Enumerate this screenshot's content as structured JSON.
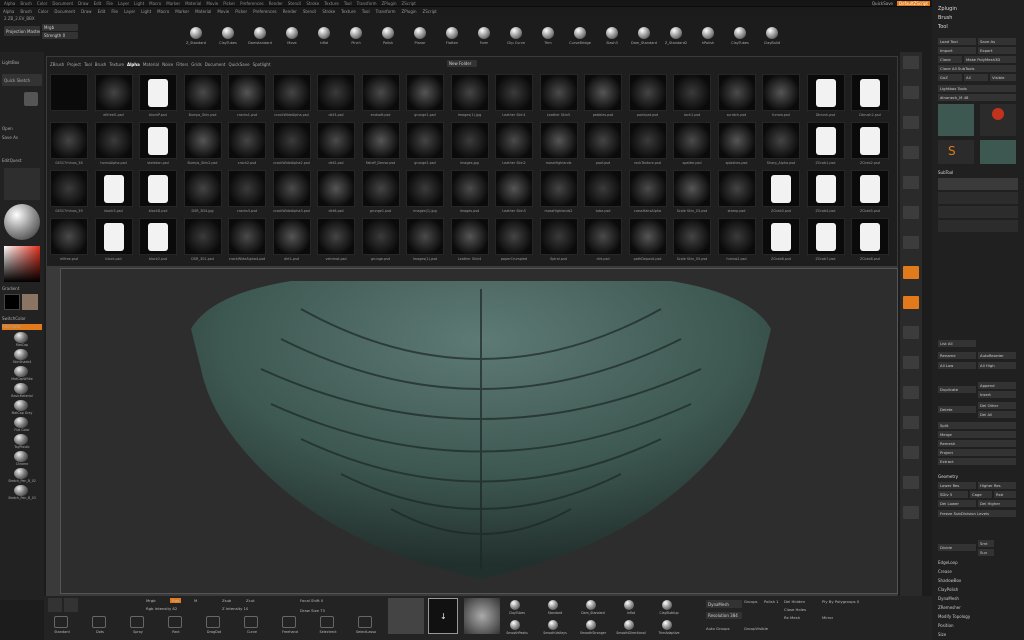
{
  "app": {
    "version": "2.ZB_2.EV_BBX",
    "status": "Active"
  },
  "top_menu": [
    "Alpha",
    "Brush",
    "Color",
    "Document",
    "Draw",
    "Edit",
    "File",
    "Layer",
    "Light",
    "Macro",
    "Marker",
    "Material",
    "Movie",
    "Picker",
    "Preferences",
    "Render",
    "Stencil",
    "Stroke",
    "Texture",
    "Tool",
    "Transform",
    "ZPlugin",
    "ZScript"
  ],
  "top_right": {
    "zplugin": "Zplugin",
    "brush": "Brush",
    "tool": "Tool",
    "quicksave": "QuickSave",
    "default": "DefaultZScript"
  },
  "left": {
    "projection_master": "Projection Master",
    "lightbox": "LightBox",
    "quick_sketch": "Quick Sketch",
    "open": "Open",
    "save_as": "Save As",
    "gradient": "Gradient",
    "switch_color": "SwitchColor",
    "alternate": "Alternate",
    "materials": [
      "MatCap",
      "SkinShade4",
      "MatCapWhite",
      "BasicMaterial",
      "MatCap Gray",
      "Flat Color",
      "ToyPlastic",
      "Chrome",
      "Sketch_Pen_B_02",
      "Sketch_Pen_B_03"
    ]
  },
  "top_shelf": [
    "Z_Standard",
    "ClayTubes",
    "Damstandard",
    "Move",
    "Inflat",
    "Pinch",
    "Polish",
    "Planar",
    "Flatten",
    "Form",
    "Clip Curve",
    "Trim",
    "CurveBridge",
    "Slash3",
    "Dam_Standard",
    "Z_Standard2",
    "hPolish",
    "ClayTubes",
    "ClayBuild"
  ],
  "draw": {
    "mrgb": "Mrgb",
    "rgb": "Rgb",
    "m": "M",
    "zadd": "Zadd",
    "zsub": "Zsub",
    "zcut": "Zcut",
    "focal_shift": "Focal Shift 0",
    "draw_size": "Draw Size 73",
    "rgb_intensity": "Rgb Intensity 82",
    "z_intensity": "Z Intensity 10",
    "strength": "Strength 0"
  },
  "popup": {
    "tabs": [
      "ZBrush",
      "Project",
      "Tool",
      "Brush",
      "Texture",
      "Alpha",
      "Material",
      "Noise",
      "Filters",
      "Grids",
      "Document",
      "QuickSave",
      "Spotlight"
    ],
    "active_tab": "Alpha",
    "new_folder": "New Folder",
    "alphas": [
      [
        "",
        "ellfreeG.psd",
        "blockP.psd",
        "Bumps_Skin.psd",
        "cracks1.psd",
        "crackWideAlpha.psd",
        "dirt3.psd",
        "endsoft.psd",
        "grunge1.psd",
        "Images(1).jpg",
        "Leather Skin1",
        "Leather Skin5",
        "pebbles.psd",
        "paintpat.psd",
        "rock1.psd",
        "scratch.psd",
        "furrow.psd",
        "Dbrush.psd",
        "Dbrush2.psd"
      ],
      [
        "04517rhinos_38",
        "hornsAlpha.psd",
        "skeleton.psd",
        "Bumps_Skin2.psd",
        "crack2.psd",
        "crackWideAlpha2.psd",
        "dirt2.psd",
        "Falloff_Dense.psd",
        "grunge2.psd",
        "images.jpg",
        "Leather Skin2",
        "mossHighlands",
        "poof.psd",
        "rockTexture.psd",
        "spatter.psd",
        "splashes.psd",
        "Sharp_Alpha.psd",
        "ZGrab1.psd",
        "ZGrab2.psd"
      ],
      [
        "04517rhinos_39",
        "block3.psd",
        "blockD.psd",
        "DSR_3D4.jpg",
        "cracks3.psd",
        "crackWideAlpha3.psd",
        "dirt6.psd",
        "grunge1.psd",
        "images(1).jpg",
        "images.psd",
        "Leather Skin3",
        "mossHighlands2",
        "tube.psd",
        "crossHairsAlpha",
        "Scale Skin_03.psd",
        "stamp.psd",
        "ZGrab3.psd",
        "ZGrab4.psd",
        "ZGrab5.psd"
      ],
      [
        "ellfree.psd",
        "block.psd",
        "block2.psd",
        "DSR_301.psd",
        "crackWideAlpha4.psd",
        "dirt1.psd",
        "veinmat.psd",
        "grunge.psd",
        "Images(1).psd",
        "Leather Skin4",
        "paperCrumpled",
        "Spiral.psd",
        "dirt.psd",
        "pathDeposit.psd",
        "Scale Skin_05.psd",
        "furrow2.psd",
        "ZGrab6.psd",
        "ZGrab7.psd",
        "ZGrab8.psd"
      ]
    ]
  },
  "right_tools": [
    "Zoom",
    "Actual",
    "AAHalf",
    "Persp",
    "Floor",
    "Local",
    "XYZ",
    "Frame",
    "Move",
    "Scale",
    "Rotate",
    "Transp",
    "Ghost",
    "Solo",
    "Xpose",
    "PolyF"
  ],
  "right": {
    "load_tool": "Load Tool",
    "save_as": "Save As",
    "import": "Import",
    "export": "Export",
    "clone": "Clone",
    "make_polymesh": "Make PolyMesh3D",
    "goz": "GoZ",
    "all": "All",
    "visible": "Visible",
    "clone_all": "Clone All SubTools",
    "lightbox_tools": "Lightbox Tools",
    "subtool_name": "dinoneck_M 48",
    "subtool": "SubTool",
    "list_all": "List All",
    "rename": "Rename",
    "autoreorder": "AutoReorder",
    "all_low": "All Low",
    "all_high": "All High",
    "duplicate": "Duplicate",
    "append": "Append",
    "insert": "Insert",
    "delete": "Delete",
    "del_other": "Del Other",
    "del_all": "Del All",
    "split": "Split",
    "merge": "Merge",
    "remesh": "Remesh",
    "project": "Project",
    "extract": "Extract",
    "geometry": "Geometry",
    "lower_res": "Lower Res",
    "higher_res": "Higher Res",
    "sdiv": "SDiv 5",
    "cage": "Cage",
    "rstr": "Rstr",
    "del_lower": "Del Lower",
    "del_higher": "Del Higher",
    "freeze": "Freeze SubDivision Levels",
    "divide": "Divide",
    "smt": "Smt",
    "suv": "Suv",
    "items": [
      "EdgeLoop",
      "Crease",
      "ShadowBox",
      "ClayPolish",
      "DynaMesh",
      "ZRemesher",
      "Modify Topology",
      "Position",
      "Size"
    ]
  },
  "bottom": {
    "dynamesh": "DynaMesh",
    "groups": "Groups",
    "polish": "Polish 1",
    "resolution": "Resolution 384",
    "del_hidden": "Del Hidden",
    "close_holes": "Close Holes",
    "re_mesh": "Re Mesh",
    "auto_groups": "Auto Groups",
    "group_visible": "GroupVisible",
    "tools": [
      "Standard",
      "Dots",
      "Spray",
      "Rect",
      "DragDot",
      "Curve",
      "Freehand",
      "Selectrect",
      "SelectLasso"
    ],
    "brush_icons": [
      "ClayTubes",
      "Standard",
      "Dam_Standard",
      "Inflat",
      "ClayBuildup",
      "SmoothPeaks",
      "SmoothValleys",
      "SmoothStronger",
      "SmoothDirectional",
      "TrimAdaptive"
    ],
    "mirror": "Mirror",
    "polygroupit": "Ply By Polygroups 0"
  }
}
